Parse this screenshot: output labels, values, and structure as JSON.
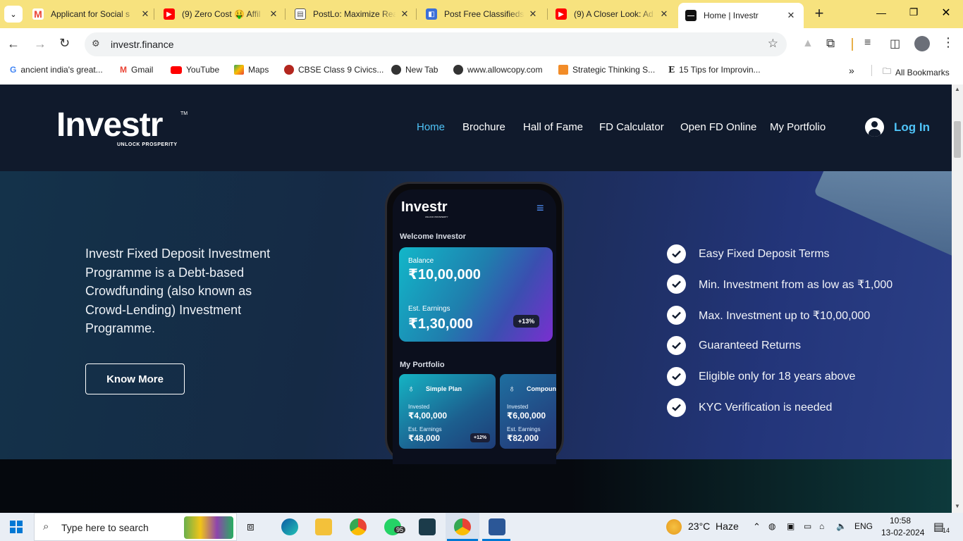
{
  "browser": {
    "tabs": [
      {
        "title": "Applicant for Social s",
        "icon": "gmail-icon",
        "color": "#ea4335"
      },
      {
        "title": "(9) Zero Cost 🤑 Affil",
        "icon": "youtube-icon",
        "color": "#ff0000"
      },
      {
        "title": "PostLo: Maximize Rea",
        "icon": "postlo-icon",
        "color": "#5f6368"
      },
      {
        "title": "Post Free Classifieds",
        "icon": "classifieds-icon",
        "color": "#3b6fd8"
      },
      {
        "title": "(9) A Closer Look: Ad",
        "icon": "youtube-icon",
        "color": "#ff0000"
      },
      {
        "title": "Home | Investr",
        "icon": "investr-icon",
        "color": "#111111"
      }
    ],
    "url": "investr.finance",
    "bookmarks": [
      {
        "label": "ancient india's great...",
        "icon": "google-icon"
      },
      {
        "label": "Gmail",
        "icon": "gmail-icon"
      },
      {
        "label": "YouTube",
        "icon": "youtube-icon"
      },
      {
        "label": "Maps",
        "icon": "maps-icon"
      },
      {
        "label": "CBSE Class 9 Civics...",
        "icon": "cbse-icon"
      },
      {
        "label": "New Tab",
        "icon": "globe-icon"
      },
      {
        "label": "www.allowcopy.com",
        "icon": "globe-icon"
      },
      {
        "label": "Strategic Thinking S...",
        "icon": "s-icon"
      },
      {
        "label": "15 Tips for Improvin...",
        "icon": "e-icon"
      }
    ],
    "all_bookmarks": "All Bookmarks"
  },
  "site": {
    "logo": "Investr",
    "logo_tm": "TM",
    "logo_tagline": "UNLOCK PROSPERITY",
    "nav": [
      "Home",
      "Brochure",
      "Hall of Fame",
      "FD Calculator",
      "Open FD Online",
      "My Portfolio"
    ],
    "login": "Log In",
    "accent": "#4fc3f7"
  },
  "hero": {
    "description": "Investr Fixed Deposit Investment Programme is a Debt-based Crowdfunding (also known as Crowd-Lending) Investment Programme.",
    "cta": "Know More",
    "features": [
      "Easy Fixed Deposit Terms",
      "Min. Investment from as low as ₹1,000",
      "Max. Investment up to ₹10,00,000",
      "Guaranteed Returns",
      "Eligible only for 18 years above",
      "KYC Verification is needed"
    ]
  },
  "phone": {
    "brand": "Investr",
    "brand_tagline": "UNLOCK PROSPERITY",
    "welcome": "Welcome Investor",
    "balance_label": "Balance",
    "balance": "₹10,00,000",
    "earnings_label": "Est. Earnings",
    "earnings": "₹1,30,000",
    "earnings_pct": "+13%",
    "portfolio_title": "My Portfolio",
    "plans": [
      {
        "name": "Simple Plan",
        "invested_label": "Invested",
        "invested": "₹4,00,000",
        "earn_label": "Est. Earnings",
        "earn": "₹48,000",
        "pct": "+12%"
      },
      {
        "name": "Compound",
        "invested_label": "Invested",
        "invested": "₹6,00,000",
        "earn_label": "Est. Earnings",
        "earn": "₹82,000",
        "pct": ""
      }
    ]
  },
  "taskbar": {
    "search_placeholder": "Type here to search",
    "weather": "23°C  Haze",
    "lang": "ENG",
    "time": "10:58",
    "date": "13-02-2024",
    "whatsapp_badge": "95",
    "notif_count": "14"
  }
}
